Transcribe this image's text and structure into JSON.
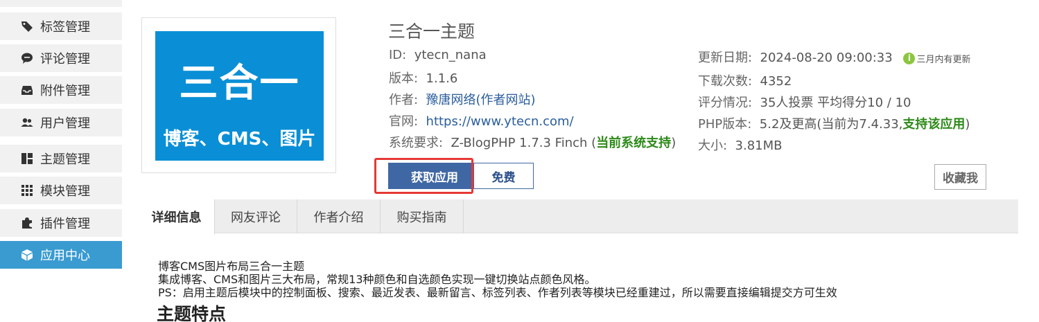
{
  "sidebar": {
    "items": [
      {
        "label": "标签管理",
        "icon": "tag-icon"
      },
      {
        "label": "评论管理",
        "icon": "comment-icon"
      },
      {
        "label": "附件管理",
        "icon": "inbox-icon"
      },
      {
        "label": "用户管理",
        "icon": "users-icon"
      },
      {
        "label": "主题管理",
        "icon": "layout-icon"
      },
      {
        "label": "模块管理",
        "icon": "grid-icon"
      },
      {
        "label": "插件管理",
        "icon": "puzzle-icon"
      },
      {
        "label": "应用中心",
        "icon": "cube-icon"
      }
    ],
    "active_index": 7
  },
  "thumbnail": {
    "big_text": "三合一",
    "small_text": "博客、CMS、图片",
    "bg_color": "#0a8fd6"
  },
  "app": {
    "title": "三合一主题",
    "id_label": "ID:",
    "id_value": "ytecn_nana",
    "version_label": "版本:",
    "version_value": "1.1.6",
    "author_label": "作者:",
    "author_value": "豫唐网络(作者网站)",
    "site_label": "官网:",
    "site_value": "https://www.ytecn.com/",
    "req_label": "系统要求:",
    "req_value": "Z-BlogPHP 1.7.3 Finch",
    "req_open": " (",
    "req_ok": "当前系统支持",
    "req_close": ")",
    "update_label": "更新日期:",
    "update_value": "2024-08-20 09:00:33",
    "update_badge_icon": "i",
    "update_badge": "三月内有更新",
    "downloads_label": "下载次数:",
    "downloads_value": "4352",
    "rating_label": "评分情况:",
    "rating_value": "35人投票 平均得分10 / 10",
    "php_label": "PHP版本:",
    "php_value": "5.2及更高(当前为7.4.33,",
    "php_ok": "支持该应用",
    "php_close": ")",
    "size_label": "大小:",
    "size_value": "3.81MB"
  },
  "buttons": {
    "get": "获取应用",
    "free": "免费",
    "favorite": "收藏我"
  },
  "tabs": [
    "详细信息",
    "网友评论",
    "作者介绍",
    "购买指南"
  ],
  "description": {
    "line1": "博客CMS图片布局三合一主题",
    "line2": "集成博客、CMS和图片三大布局，常规13种颜色和自选颜色实现一键切换站点颜色风格。",
    "line3": "PS：启用主题后模块中的控制面板、搜索、最近发表、最新留言、标签列表、作者列表等模块已经重建过，所以需要直接编辑提交方可生效",
    "heading": "主题特点"
  },
  "colors": {
    "accent": "#3f67a4",
    "active_sidebar": "#3a9bd1",
    "ok_green": "#2d8a19",
    "highlight_red": "#e53935"
  }
}
